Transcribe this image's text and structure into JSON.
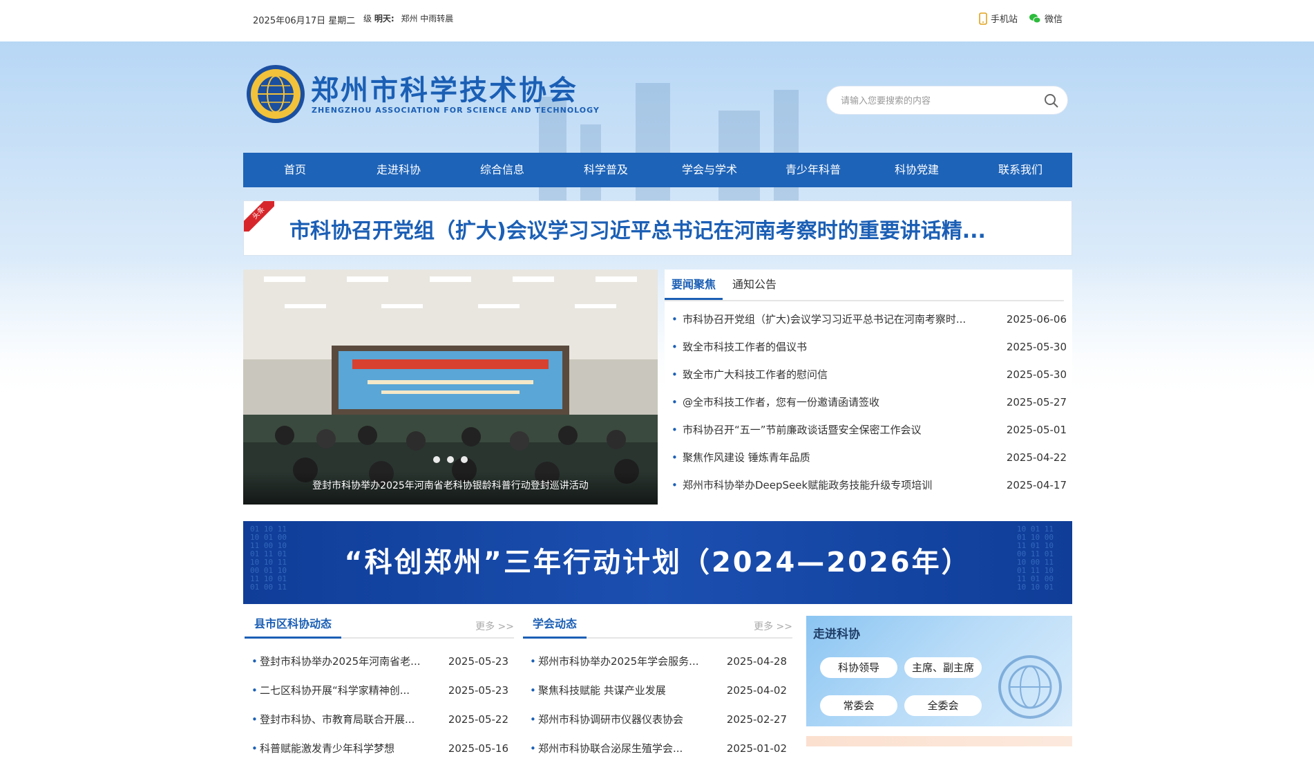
{
  "topbar": {
    "date": "2025年06月17日 星期二",
    "weather_grade": "级",
    "weather_label": "明天:",
    "weather_value": "郑州 中雨转晨",
    "mobile_label": "手机站",
    "wechat_label": "微信"
  },
  "site": {
    "title": "郑州市科学技术协会",
    "subtitle": "ZHENGZHOU ASSOCIATION FOR SCIENCE AND TECHNOLOGY"
  },
  "search": {
    "placeholder": "请输入您要搜索的内容"
  },
  "nav": [
    "首页",
    "走进科协",
    "综合信息",
    "科学普及",
    "学会与学术",
    "青少年科普",
    "科协党建",
    "联系我们"
  ],
  "headline": {
    "tag": "头条",
    "text": "市科协召开党组（扩大)会议学习习近平总书记在河南考察时的重要讲话精..."
  },
  "slider": {
    "caption": "登封市科协举办2025年河南省老科协银龄科普行动登封巡讲活动"
  },
  "news": {
    "tabs": [
      "要闻聚焦",
      "通知公告"
    ],
    "items": [
      {
        "title": "市科协召开党组（扩大)会议学习习近平总书记在河南考察时...",
        "date": "2025-06-06"
      },
      {
        "title": "致全市科技工作者的倡议书",
        "date": "2025-05-30"
      },
      {
        "title": "致全市广大科技工作者的慰问信",
        "date": "2025-05-30"
      },
      {
        "title": "@全市科技工作者，您有一份邀请函请签收",
        "date": "2025-05-27"
      },
      {
        "title": "市科协召开“五一”节前廉政谈话暨安全保密工作会议",
        "date": "2025-05-01"
      },
      {
        "title": "聚焦作风建设 锤炼青年品质",
        "date": "2025-04-22"
      },
      {
        "title": "郑州市科协举办DeepSeek赋能政务技能升级专项培训",
        "date": "2025-04-17"
      }
    ]
  },
  "plan_banner": {
    "text": "“科创郑州”三年行动计划（2024—2026年）"
  },
  "county": {
    "title": "县市区科协动态",
    "more": "更多 >>",
    "items": [
      {
        "title": "登封市科协举办2025年河南省老...",
        "date": "2025-05-23"
      },
      {
        "title": "二七区科协开展“科学家精神创...",
        "date": "2025-05-23"
      },
      {
        "title": "登封市科协、市教育局联合开展...",
        "date": "2025-05-22"
      },
      {
        "title": "科普赋能激发青少年科学梦想",
        "date": "2025-05-16"
      }
    ]
  },
  "society": {
    "title": "学会动态",
    "more": "更多 >>",
    "items": [
      {
        "title": "郑州市科协举办2025年学会服务...",
        "date": "2025-04-28"
      },
      {
        "title": "聚焦科技赋能 共谋产业发展",
        "date": "2025-04-02"
      },
      {
        "title": "郑州市科协调研市仪器仪表协会",
        "date": "2025-02-27"
      },
      {
        "title": "郑州市科协联合泌尿生殖学会...",
        "date": "2025-01-02"
      }
    ]
  },
  "about": {
    "title": "走进科协",
    "buttons": [
      "科协领导",
      "主席、副主席",
      "常委会",
      "全委会"
    ]
  },
  "colors": {
    "brand_blue": "#1d63b8",
    "headline_red": "#d7262b",
    "banner_navy": "#0f3d98"
  }
}
